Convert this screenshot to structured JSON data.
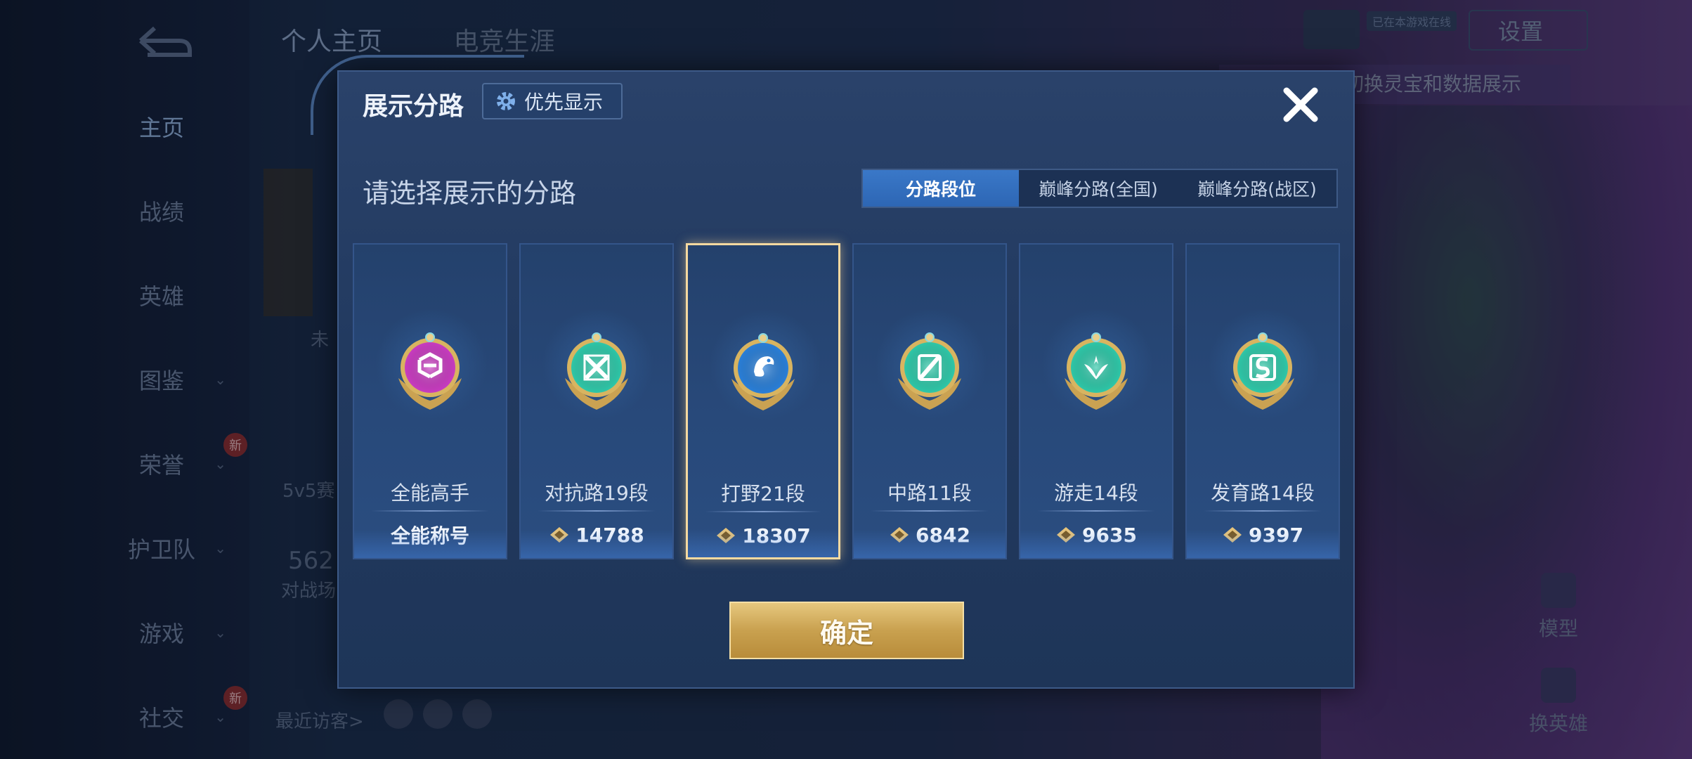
{
  "background": {
    "nav": [
      {
        "label": "主页",
        "active": true
      },
      {
        "label": "战绩"
      },
      {
        "label": "英雄"
      },
      {
        "label": "图鉴",
        "chevron": true
      },
      {
        "label": "荣誉",
        "chevron": true,
        "badge": "新"
      },
      {
        "label": "护卫队",
        "chevron": true
      },
      {
        "label": "游戏",
        "chevron": true
      },
      {
        "label": "社交",
        "chevron": true,
        "badge": "新"
      }
    ],
    "tabs": [
      "个人主页",
      "电竞生涯"
    ],
    "settings_label": "设置",
    "online_tag": "已在本游戏在线",
    "banner_text": "以切换灵宝和数据展示",
    "model_label": "模型",
    "switch_hero_label": "换英雄",
    "recent_visitors": "最近访客>",
    "stat_5v5": "5v5赛",
    "stat_number": "562",
    "stat_label": "对战场",
    "profile_status": "未"
  },
  "modal": {
    "title": "展示分路",
    "priority_label": "优先显示",
    "subtitle": "请选择展示的分路",
    "segments": [
      {
        "label": "分路段位",
        "active": true
      },
      {
        "label": "巅峰分路(全国)"
      },
      {
        "label": "巅峰分路(战区)"
      }
    ],
    "cards": [
      {
        "name": "all-round",
        "label": "全能高手",
        "value": "全能称号",
        "value_icon": false,
        "color": "#c83cc0",
        "symbol": "allround",
        "selected": false
      },
      {
        "name": "clash-lane",
        "label": "对抗路19段",
        "value": "14788",
        "value_icon": true,
        "color": "#2fc7a8",
        "symbol": "clash",
        "selected": false
      },
      {
        "name": "jungle",
        "label": "打野21段",
        "value": "18307",
        "value_icon": true,
        "color": "#2a7fd8",
        "symbol": "jungle",
        "selected": true
      },
      {
        "name": "mid-lane",
        "label": "中路11段",
        "value": "6842",
        "value_icon": true,
        "color": "#2fc7a8",
        "symbol": "mid",
        "selected": false
      },
      {
        "name": "roam",
        "label": "游走14段",
        "value": "9635",
        "value_icon": true,
        "color": "#2fc7a8",
        "symbol": "roam",
        "selected": false
      },
      {
        "name": "farm-lane",
        "label": "发育路14段",
        "value": "9397",
        "value_icon": true,
        "color": "#2fc7a8",
        "symbol": "farm",
        "selected": false
      }
    ],
    "confirm_label": "确定"
  }
}
